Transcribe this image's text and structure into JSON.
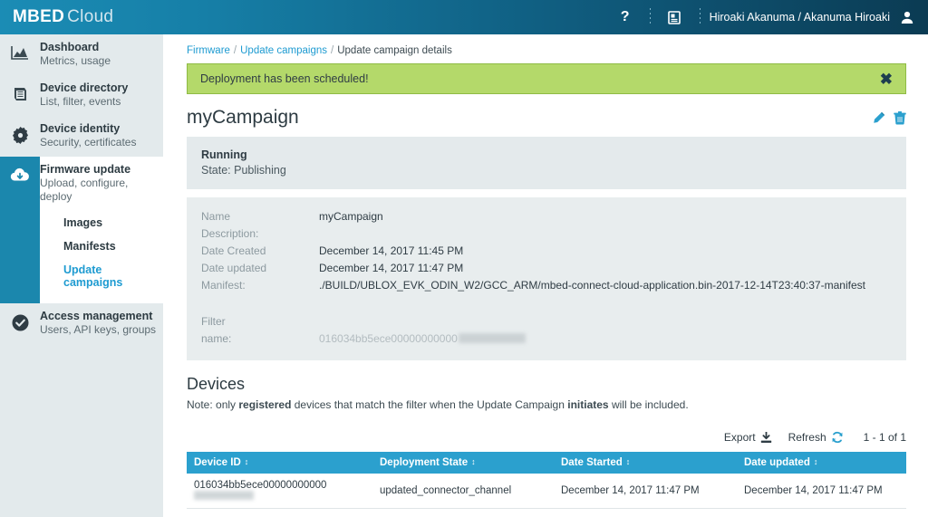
{
  "brand": {
    "bold": "MBED",
    "light": "Cloud"
  },
  "topbar": {
    "help_icon": "question-mark-icon",
    "docs_icon": "documentation-icon",
    "user_name": "Hiroaki Akanuma / Akanuma Hiroaki",
    "avatar_icon": "user-avatar-icon"
  },
  "sidebar": {
    "groups": [
      {
        "title": "Dashboard",
        "subtitle": "Metrics, usage",
        "icon": "chart-icon",
        "active": false
      },
      {
        "title": "Device directory",
        "subtitle": "List, filter, events",
        "icon": "book-icon",
        "active": false
      },
      {
        "title": "Device identity",
        "subtitle": "Security, certificates",
        "icon": "gear-star-icon",
        "active": false
      },
      {
        "title": "Firmware update",
        "subtitle": "Upload, configure, deploy",
        "icon": "cloud-download-icon",
        "active": true
      },
      {
        "title": "Access management",
        "subtitle": "Users, API keys, groups",
        "icon": "check-circle-icon",
        "active": false
      }
    ],
    "subnav": [
      {
        "label": "Images",
        "current": false
      },
      {
        "label": "Manifests",
        "current": false
      },
      {
        "label": "Update campaigns",
        "current": true
      }
    ],
    "toggle_icon": "hamburger-menu-icon"
  },
  "breadcrumb": {
    "item1": "Firmware",
    "item2": "Update campaigns",
    "current": "Update campaign details",
    "separator": "/"
  },
  "alert": {
    "message": "Deployment has been scheduled!",
    "close_label": "✖",
    "background": "#b4d96a"
  },
  "page": {
    "title": "myCampaign",
    "edit_icon": "pencil-edit-icon",
    "delete_icon": "trash-delete-icon",
    "accent": "#1e9bd1"
  },
  "status": {
    "title": "Running",
    "subtitle": "State: Publishing"
  },
  "details": {
    "rows": [
      {
        "key": "Name",
        "value": "myCampaign"
      },
      {
        "key": "Description:",
        "value": ""
      },
      {
        "key": "Date Created",
        "value": "December 14, 2017 11:45 PM"
      },
      {
        "key": "Date updated",
        "value": "December 14, 2017 11:47 PM"
      },
      {
        "key": "Manifest:",
        "value": "./BUILD/UBLOX_EVK_ODIN_W2/GCC_ARM/mbed-connect-cloud-application.bin-2017-12-14T23:40:37-manifest"
      }
    ],
    "filter_label": "Filter",
    "filter_key": "name:",
    "filter_value": "016034bb5ece00000000000"
  },
  "devices": {
    "heading": "Devices",
    "note_prefix": "Note: only ",
    "note_bold1": "registered",
    "note_middle": " devices that match the filter when the Update Campaign ",
    "note_bold2": "initiates",
    "note_suffix": " will be included.",
    "export_label": "Export",
    "export_icon": "download-icon",
    "refresh_label": "Refresh",
    "refresh_icon": "refresh-icon",
    "pagination": "1 - 1 of 1",
    "columns": [
      {
        "label": "Device ID",
        "sort": "↕"
      },
      {
        "label": "Deployment State",
        "sort": "↕"
      },
      {
        "label": "Date Started",
        "sort": "↕"
      },
      {
        "label": "Date updated",
        "sort": "↕"
      }
    ],
    "rows": [
      {
        "device_id": "016034bb5ece00000000000",
        "deployment_state": "updated_connector_channel",
        "date_started": "December 14, 2017 11:47 PM",
        "date_updated": "December 14, 2017 11:47 PM"
      }
    ],
    "header_color": "#2ba0ce"
  }
}
